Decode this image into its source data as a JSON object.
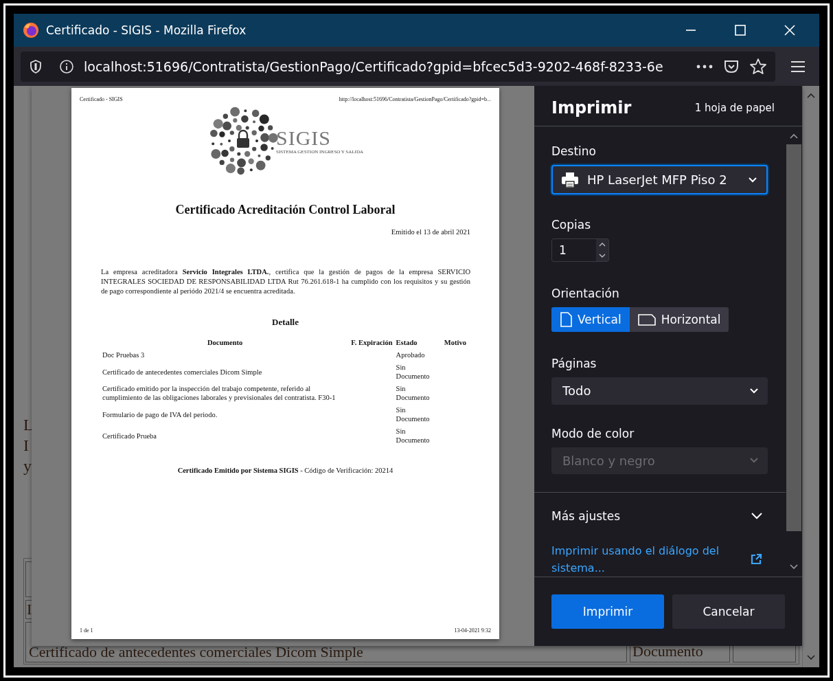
{
  "window": {
    "title": "Certificado - SIGIS - Mozilla Firefox"
  },
  "address_bar": {
    "url": "localhost:51696/Contratista/GestionPago/Certificado?gpid=bfcec5d3-9202-468f-8233-6e"
  },
  "background_page": {
    "text_fragments": [
      "L",
      "I",
      "y"
    ],
    "cut_cell": "I",
    "document_cell": "Certificado de antecedentes comerciales Dicom Simple",
    "status_cell": "Documento"
  },
  "preview": {
    "header_left": "Certificado - SIGIS",
    "header_right": "http://localhost:51696/Contratista/GestionPago/Certificado?gpid=b...",
    "logo_name": "SIGIS",
    "logo_subtitle": "SISTEMA GESTION INGRESO Y SALIDA",
    "title": "Certificado Acreditación Control Laboral",
    "issued": "Emitido el 13 de abril 2021",
    "paragraph": "La empresa acreditadora **Servicio Integrales LTDA.**, certifica que la gestión de pagos de la empresa SERVICIO INTEGRALES SOCIEDAD DE RESPONSABILIDAD LTDA Rut 76.261.618-1 ha cumplido con los requisitos y su gestión de pago correspondiente al periódo 2021/4 se encuentra acreditada.",
    "detail_heading": "Detalle",
    "columns": [
      "Documento",
      "F. Expiración",
      "Estado",
      "Motivo"
    ],
    "rows": [
      {
        "document": "Doc Pruebas 3",
        "status": "Aprobado"
      },
      {
        "document": "Certificado de antecedentes comerciales Dicom Simple",
        "status": "Sin Documento"
      },
      {
        "document": "Certificado emitido por la inspección del trabajo competente, referido al cumplimiento de las obligaciones laborales y previsionales del contratista. F30-1",
        "status": "Sin Documento"
      },
      {
        "document": "Formulario de pago de IVA del periodo.",
        "status": "Sin Documento"
      },
      {
        "document": "Certificado Prueba",
        "status": "Sin Documento"
      }
    ],
    "footer_note": "**Certificado Emitido por Sistema SIGIS** - Código de Verificación: 20214",
    "page_count": "1 de 1",
    "printed_at": "13-04-2021 9:32"
  },
  "print_panel": {
    "title": "Imprimir",
    "sheets": "1 hoja de papel",
    "destination": {
      "label": "Destino",
      "value": "HP LaserJet MFP Piso 2"
    },
    "copies": {
      "label": "Copias",
      "value": "1"
    },
    "orientation": {
      "label": "Orientación",
      "options": [
        {
          "label": "Vertical",
          "kind": "portrait",
          "selected": true
        },
        {
          "label": "Horizontal",
          "kind": "landscape",
          "selected": false
        }
      ]
    },
    "pages": {
      "label": "Páginas",
      "value": "Todo"
    },
    "color_mode": {
      "label": "Modo de color",
      "value": "Blanco y negro",
      "disabled": true
    },
    "more_settings": "Más ajustes",
    "system_dialog_link": "Imprimir usando el diálogo del sistema...",
    "buttons": [
      {
        "label": "Imprimir",
        "kind": "primary"
      },
      {
        "label": "Cancelar",
        "kind": "secondary"
      }
    ]
  }
}
